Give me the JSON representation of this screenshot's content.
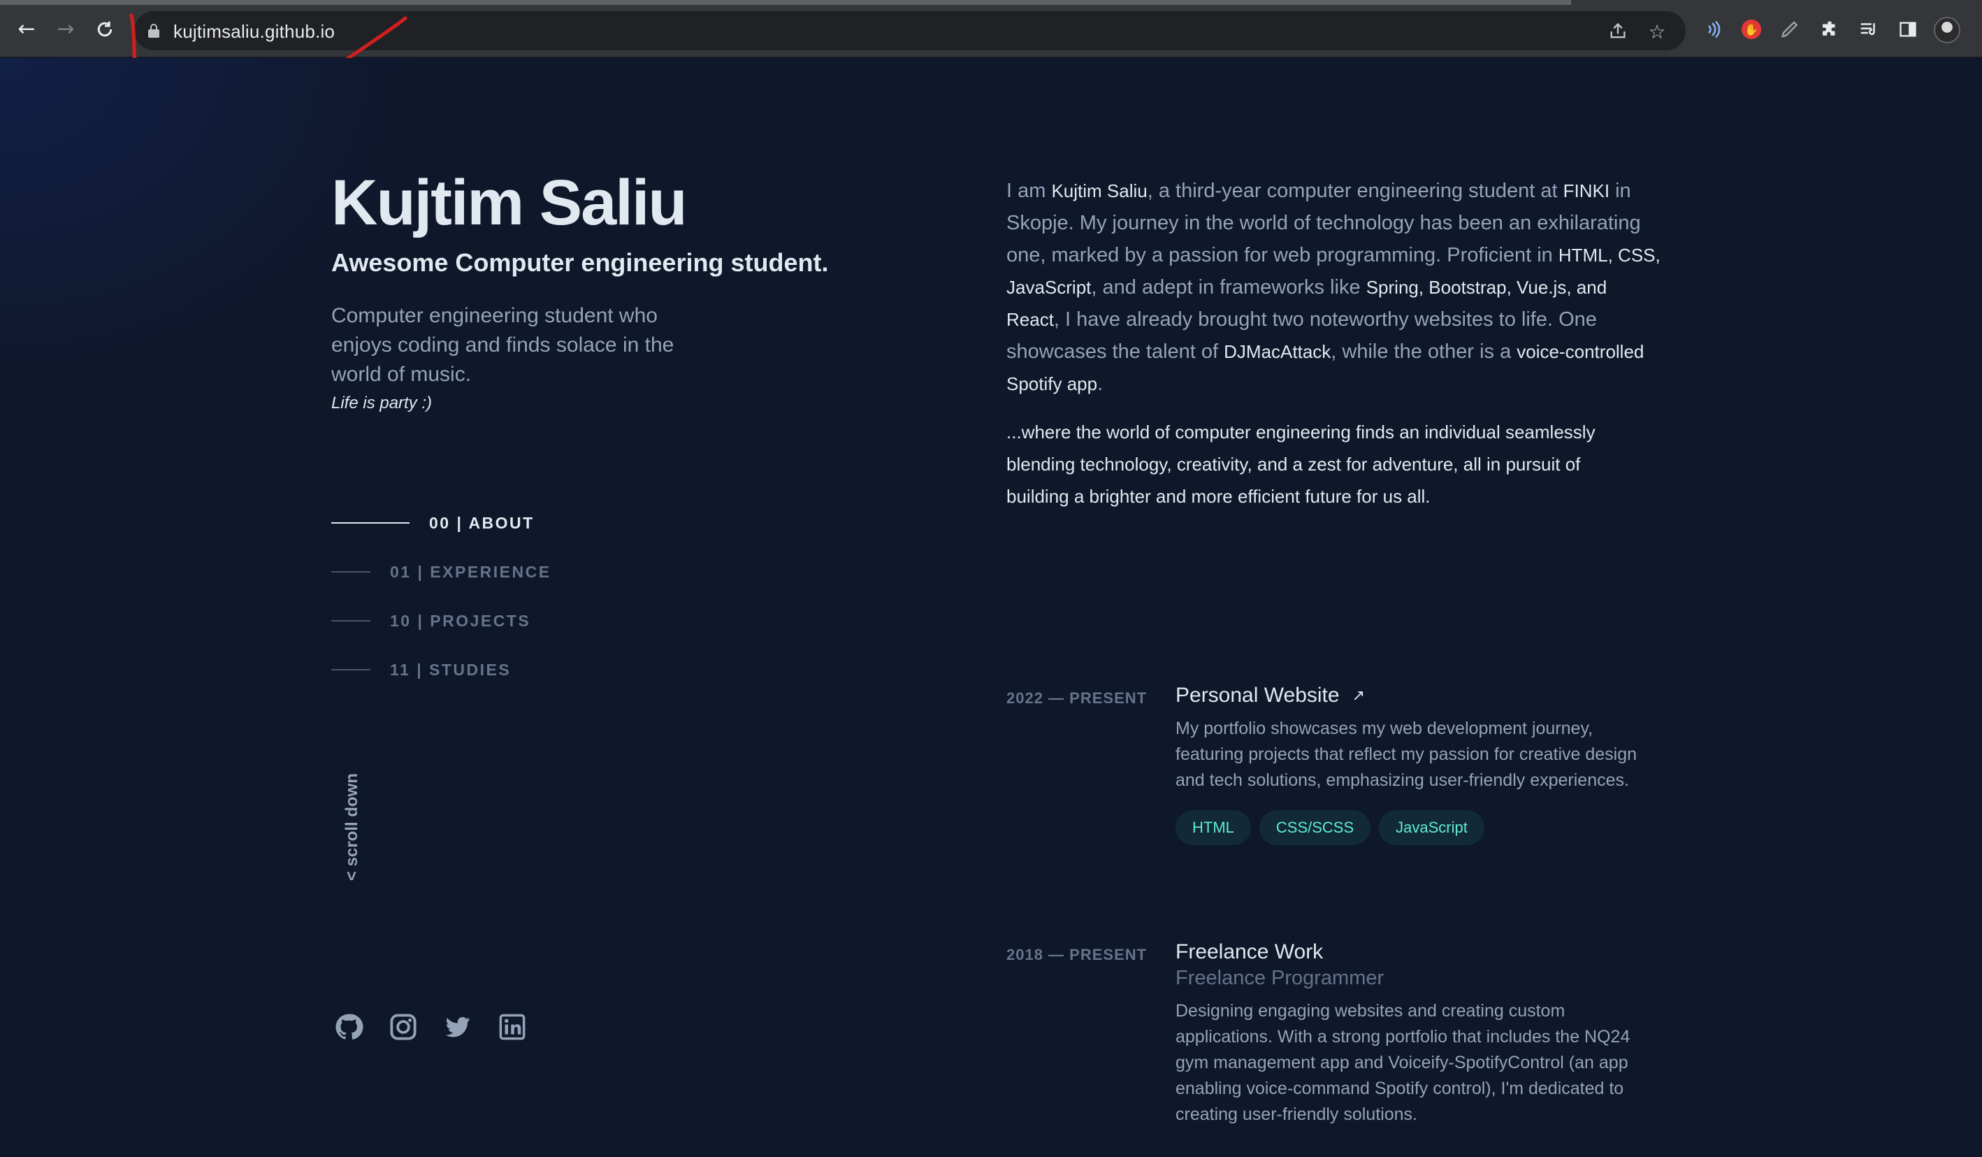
{
  "browser": {
    "url": "kujtimsaliu.github.io",
    "back_icon": "arrow-left-icon",
    "forward_icon": "arrow-right-icon",
    "reload_icon": "reload-icon"
  },
  "profile": {
    "name": "Kujtim Saliu",
    "tagline": "Awesome Computer engineering student.",
    "bio": "Computer engineering student who enjoys coding and finds solace in the world of music.",
    "motto": "Life is party :)"
  },
  "nav": [
    {
      "label": "00 | ABOUT",
      "active": true
    },
    {
      "label": "01 | EXPERIENCE",
      "active": false
    },
    {
      "label": "10 | PROJECTS",
      "active": false
    },
    {
      "label": "11 | STUDIES",
      "active": false
    }
  ],
  "scroll_hint": "< scroll down",
  "socials": [
    "github-icon",
    "instagram-icon",
    "twitter-icon",
    "linkedin-icon"
  ],
  "about": {
    "p1": {
      "t1": "I am ",
      "h1": "Kujtim Saliu",
      "t2": ", a third-year computer engineering student at ",
      "h2": "FINKI",
      "t3": " in Skopje. My journey in the world of technology has been an exhilarating one, marked by a passion for web programming. Proficient in ",
      "h3": "HTML, CSS, JavaScript",
      "t4": ", and adept in frameworks like ",
      "h4": "Spring, Bootstrap, Vue.js, and React",
      "t5": ", I have already brought two noteworthy websites to life. One showcases the talent of ",
      "h5": "DJMacAttack",
      "t6": ", while the other is a ",
      "h6": "voice-controlled Spotify app",
      "t7": "."
    },
    "p2": "...where the world of computer engineering finds an individual seamlessly blending technology, creativity, and a zest for adventure, all in pursuit of building a brighter and more efficient future for us all."
  },
  "experience": [
    {
      "date": "2022 — PRESENT",
      "title": "Personal Website",
      "subtitle": "",
      "description": "My portfolio showcases my web development journey, featuring projects that reflect my passion for creative design and tech solutions, emphasizing user-friendly experiences.",
      "tags": [
        "HTML",
        "CSS/SCSS",
        "JavaScript"
      ]
    },
    {
      "date": "2018 — PRESENT",
      "title": "Freelance Work",
      "subtitle": "Freelance Programmer",
      "description": "Designing engaging websites and creating custom applications. With a strong portfolio that includes the NQ24 gym management app and Voiceify-SpotifyControl (an app enabling voice-command Spotify control), I'm dedicated to creating user-friendly solutions."
    }
  ]
}
